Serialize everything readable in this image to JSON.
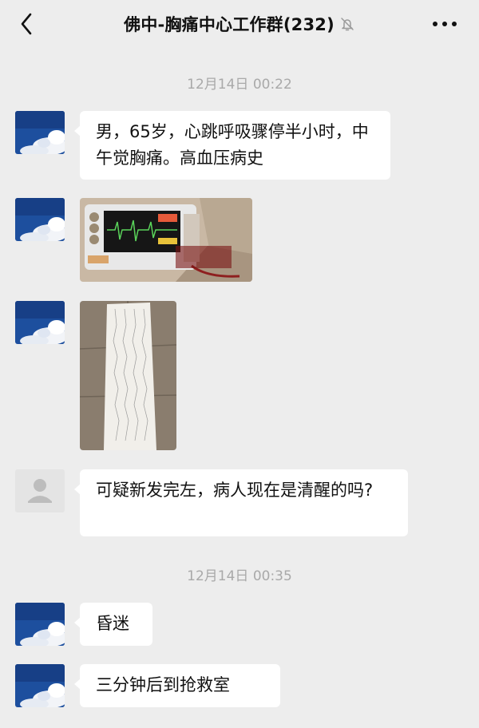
{
  "header": {
    "title": "佛中-胸痛中心工作群(232)",
    "back_icon": "chevron-left-icon",
    "mute_icon": "bell-off-icon",
    "more_icon": "more-dots-icon"
  },
  "messages": [
    {
      "type": "time",
      "text": "12月14日 00:22"
    },
    {
      "type": "text",
      "sender_avatar": "sky-avatar",
      "text": "男，65岁，心跳呼吸骤停半小时，中午觉胸痛。高血压病史"
    },
    {
      "type": "image",
      "sender_avatar": "sky-avatar",
      "image": "monitor-photo"
    },
    {
      "type": "image",
      "sender_avatar": "sky-avatar",
      "image": "ecg-strip-photo"
    },
    {
      "type": "text",
      "sender_avatar": "default-user-avatar",
      "text": "可疑新发完左，病人现在是清醒的吗?"
    },
    {
      "type": "time",
      "text": "12月14日 00:35"
    },
    {
      "type": "text",
      "sender_avatar": "sky-avatar",
      "text": "昏迷"
    },
    {
      "type": "text",
      "sender_avatar": "sky-avatar",
      "text": "三分钟后到抢救室"
    }
  ],
  "colors": {
    "background": "#ededed",
    "bubble": "#ffffff",
    "timestamp": "#a9a9a9"
  }
}
